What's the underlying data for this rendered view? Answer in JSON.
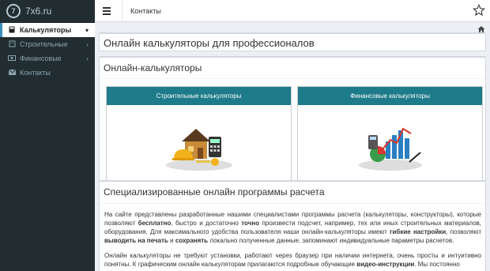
{
  "sidebar": {
    "logo_text": "7x6.ru",
    "logo_mark": "7",
    "items": [
      {
        "label": "Калькуляторы",
        "icon": "calculator-icon",
        "active": true
      },
      {
        "label": "Строительные",
        "icon": "building-icon",
        "active": false
      },
      {
        "label": "Финансовые",
        "icon": "money-icon",
        "active": false
      },
      {
        "label": "Контакты",
        "icon": "envelope-icon",
        "active": false
      }
    ]
  },
  "header": {
    "link": "Контакты"
  },
  "main": {
    "page_title": "Онлайн калькуляторы для профессионалов",
    "section1_title": "Онлайн-калькуляторы",
    "cards": [
      {
        "label": "Строительные калькуляторы"
      },
      {
        "label": "Финансовые калькуляторы"
      }
    ],
    "section2_title": "Специализированные онлайн программы расчета",
    "para1": {
      "t1": "На сайте представлены разработанные нашими специалистами программы расчета (калькуляторы, конструкторы), которые позволяют ",
      "b1": "бесплатно",
      "t2": ", быстро и достаточно ",
      "b2": "точно",
      "t3": " произвести подсчет, например, тех или иных строительных материалов, оборудования. Для максимального удобства пользователя наши онлайн-калькуляторы имеют ",
      "b3": "гибкие настройки",
      "t4": ", позволяют ",
      "b4": "выводить на печать",
      "t5": " и ",
      "b5": "сохранять",
      "t6": " локально полученные данные, запоминают индивидуальные параметры расчетов."
    },
    "para2": {
      "t1": "Онлайн калькуляторы не требуют установки, работают через браузер при наличии интернета, очень просты и интуитивно понятны. К графическим онлайн калькуляторам прилагаются подробные обучающие ",
      "b1": "видео-инструкции",
      "t2": ". Мы постоянно"
    }
  }
}
